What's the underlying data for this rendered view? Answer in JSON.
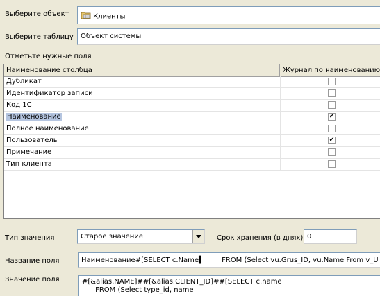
{
  "object_row": {
    "label": "Выберите объект",
    "value": "Клиенты"
  },
  "table_row": {
    "label": "Выберите таблицу",
    "value": "Объект системы"
  },
  "fields_caption": "Отметьте нужные поля",
  "grid": {
    "columns": [
      "Наименование столбца",
      "Журнал по наименованию"
    ],
    "rows": [
      {
        "name": "Дубликат",
        "checked": false,
        "mark": ""
      },
      {
        "name": "Идентификатор записи",
        "checked": false,
        "mark": ""
      },
      {
        "name": "Код 1С",
        "checked": false,
        "mark": ""
      },
      {
        "name": "Наименование",
        "checked": true,
        "mark": "✔",
        "selected": true
      },
      {
        "name": "Полное наименование",
        "checked": false,
        "mark": ""
      },
      {
        "name": "Пользователь",
        "checked": true,
        "mark": "✔"
      },
      {
        "name": "Примечание",
        "checked": false,
        "mark": ""
      },
      {
        "name": "Тип клиента",
        "checked": false,
        "mark": ""
      }
    ]
  },
  "value_type": {
    "label": "Тип значения",
    "value": "Старое значение"
  },
  "retention": {
    "label": "Срок хранения (в днях)",
    "value": "0"
  },
  "field_name": {
    "label": "Название поля",
    "value": "Наименование#[SELECT c.Name▌        FROM (Select vu.Grus_ID, vu.Name From v_U"
  },
  "field_value": {
    "label": "Значение поля",
    "line1": "#[&alias.NAME]##[&alias.CLIENT_ID]##[SELECT c.name",
    "line2": "      FROM (Select type_id, name"
  },
  "colors": {
    "window_bg": "#ece9d8",
    "selection": "#b5c5e0",
    "field_border": "#7f9db9"
  },
  "icons": {
    "object_icon": "folder-table-icon",
    "combo_arrow": "chevron-down-icon"
  }
}
